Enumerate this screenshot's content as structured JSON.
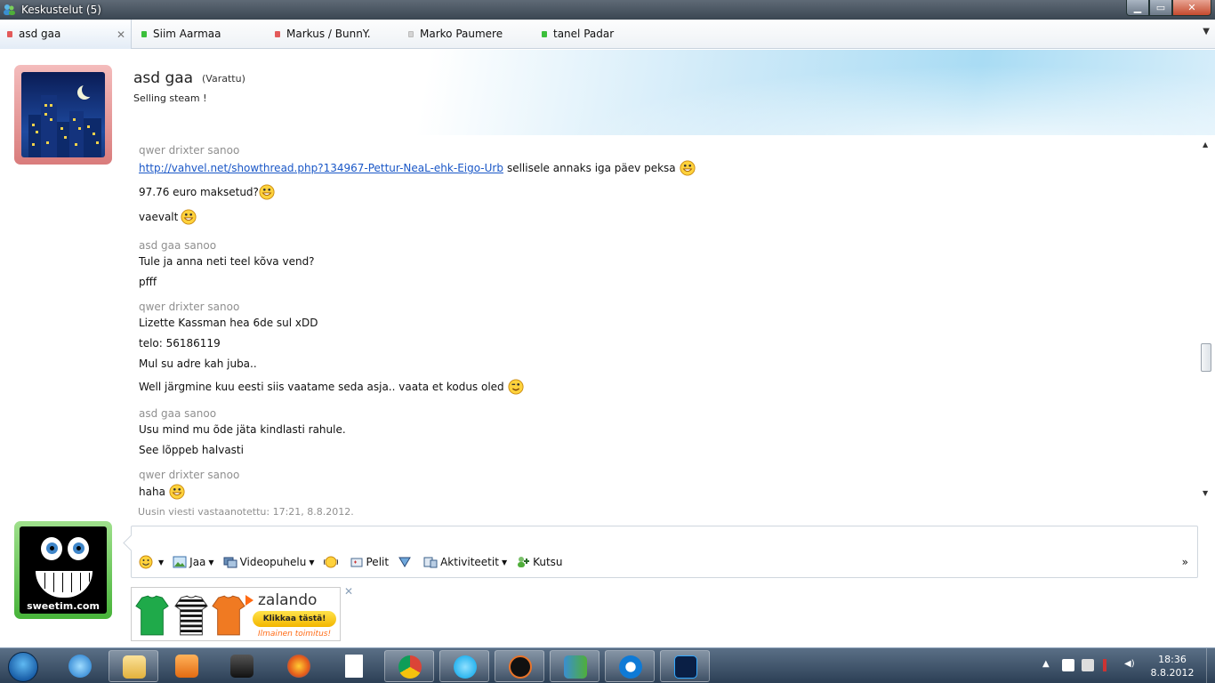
{
  "window": {
    "title": "Keskustelut (5)",
    "buttons": [
      "minimize",
      "maximize",
      "close"
    ]
  },
  "tabs": [
    {
      "label": "asd gaa",
      "color": "#e35a5a",
      "active": true
    },
    {
      "label": "Siim Aarmaa",
      "color": "#3bbf3b",
      "active": false
    },
    {
      "label": "Markus / BunnY.",
      "color": "#e35a5a",
      "active": false
    },
    {
      "label": "Marko Paumere",
      "color": "#cfcfcf",
      "active": false
    },
    {
      "label": "tanel Padar",
      "color": "#3bbf3b",
      "active": false
    }
  ],
  "contact": {
    "name": "asd gaa",
    "status": "(Varattu)",
    "mood": "Selling steam !"
  },
  "messages": [
    {
      "type": "sender",
      "text": "qwer drixter sanoo"
    },
    {
      "type": "msg",
      "link": "http://vahvel.net/showthread.php?134967-Pettur-NeaL-ehk-Eigo-Urb",
      "text": "sellisele annaks iga päev peksa",
      "emoticon": "grin-emoticon"
    },
    {
      "type": "msg",
      "text": "97.76 euro maksetud?",
      "emoticon": "grin-emoticon"
    },
    {
      "type": "msg",
      "text": "vaevalt",
      "emoticon": "grin-emoticon"
    },
    {
      "type": "sender",
      "text": "asd gaa sanoo"
    },
    {
      "type": "msg",
      "text": "Tule ja anna neti teel kõva vend?"
    },
    {
      "type": "msg",
      "text": "pfff"
    },
    {
      "type": "sender",
      "text": "qwer drixter sanoo"
    },
    {
      "type": "msg",
      "text": "Lizette Kassman hea 6de sul xDD"
    },
    {
      "type": "msg",
      "text": "telo: 56186119"
    },
    {
      "type": "msg",
      "text": "Mul su adre kah juba.."
    },
    {
      "type": "msg",
      "text": "Well järgmine kuu eesti siis vaatame seda asja.. vaata et kodus oled",
      "emoticon": "wink-emoticon"
    },
    {
      "type": "sender",
      "text": "asd gaa sanoo"
    },
    {
      "type": "msg",
      "text": "Usu mind mu õde jäta kindlasti rahule."
    },
    {
      "type": "msg",
      "text": "See lõppeb halvasti"
    },
    {
      "type": "sender",
      "text": "qwer drixter sanoo"
    },
    {
      "type": "msg",
      "text": "haha",
      "emoticon": "grin-emoticon"
    }
  ],
  "last_received": "Uusin viesti vastaanotettu: 17:21, 8.8.2012.",
  "toolbar": {
    "share": "Jaa",
    "video": "Videopuhelu",
    "games": "Pelit",
    "activities": "Aktiviteetit",
    "invite": "Kutsu",
    "more": "»"
  },
  "avatar_brand": "sweetim.com",
  "ad": {
    "brand": "zalando",
    "cta": "Klikkaa tästä!",
    "sub": "Ilmainen toimitus!"
  },
  "taskbar": {
    "items": [
      "explorer-icon",
      "ie-icon",
      "folder-icon",
      "media-player-icon",
      "laptop-icon",
      "firefox-icon",
      "blank-document-icon",
      "chrome-icon",
      "skype-icon",
      "half-life-icon",
      "messenger-icon",
      "teamviewer-icon",
      "photoshop-icon"
    ],
    "time": "18:36",
    "date": "8.8.2012"
  }
}
